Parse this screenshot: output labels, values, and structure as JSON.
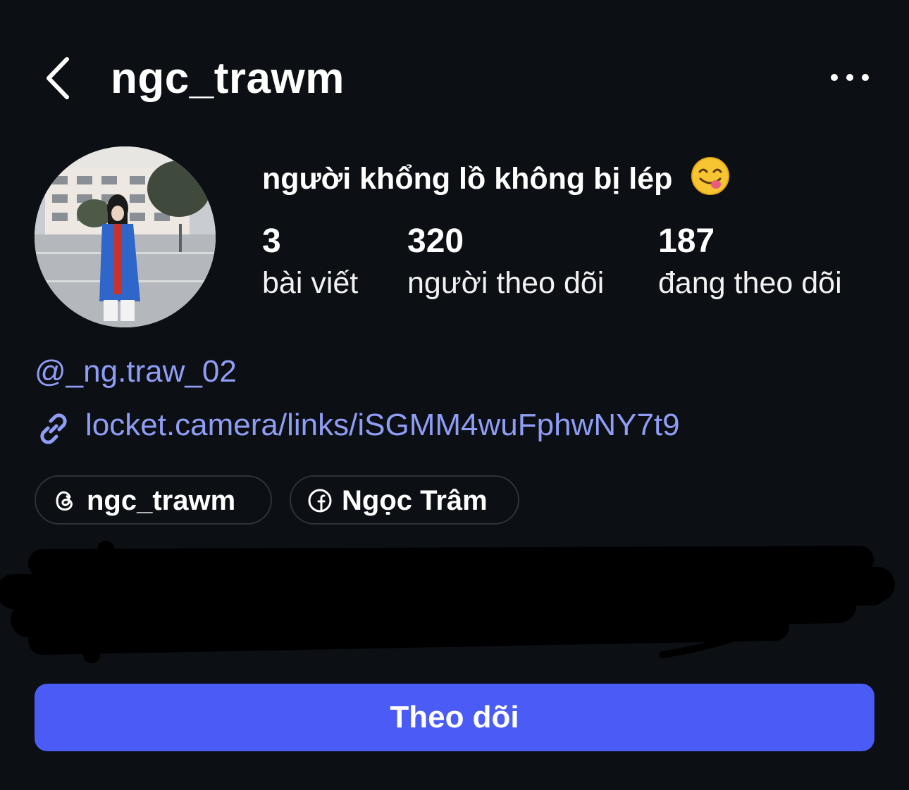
{
  "header": {
    "username": "ngc_trawm",
    "back_icon": "chevron-left-icon",
    "more_icon": "ellipsis-icon"
  },
  "profile": {
    "display_name": "người khổng lồ không bị lép",
    "display_name_emoji": "face-savoring-food-emoji",
    "stats": [
      {
        "value": "3",
        "label": "bài viết"
      },
      {
        "value": "320",
        "label": "người theo dõi"
      },
      {
        "value": "187",
        "label": "đang theo dõi"
      }
    ],
    "handle": "@_ng.traw_02",
    "link": {
      "icon": "link-icon",
      "text": "locket.camera/links/iSGMM4wuFphwNY7t9"
    },
    "chips": [
      {
        "icon": "threads-icon",
        "label": "ngc_trawm"
      },
      {
        "icon": "facebook-icon",
        "label": "Ngọc Trâm"
      }
    ]
  },
  "follow_button": {
    "label": "Theo dõi"
  },
  "colors": {
    "background": "#0c0f14",
    "link": "#8f9df5",
    "primary_button": "#4a5cf5",
    "chip_border": "#2e323a"
  }
}
